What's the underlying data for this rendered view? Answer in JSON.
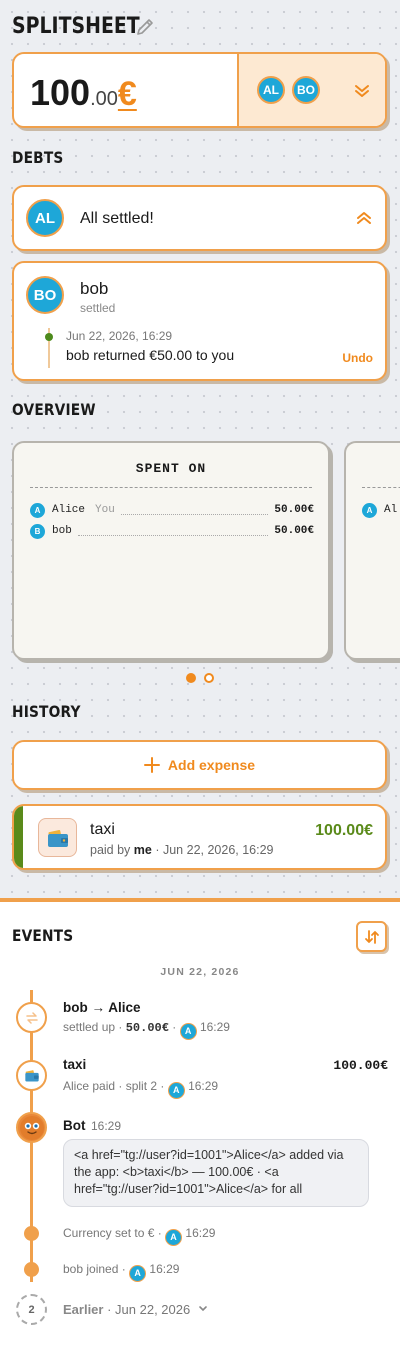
{
  "app": {
    "title": "SPLITSHEET",
    "edit_icon": "pencil-icon"
  },
  "total": {
    "integer": "100",
    "decimal": ".00",
    "currency": "€",
    "members": [
      "AL",
      "BO"
    ],
    "expand_icon": "double-chevron-down-icon"
  },
  "debts": {
    "title": "DEBTS",
    "summary": {
      "avatar": "AL",
      "text": "All settled!",
      "collapse_icon": "double-chevron-up-icon"
    },
    "entries": [
      {
        "avatar": "BO",
        "name": "bob",
        "status": "settled",
        "date": "Jun 22, 2026, 16:29",
        "message": "bob returned €50.00 to you",
        "action": "Undo"
      }
    ]
  },
  "overview": {
    "title": "OVERVIEW",
    "cards": [
      {
        "title": "SPENT ON",
        "rows": [
          {
            "badge": "A",
            "name": "Alice",
            "note": "You",
            "amount": "50.00€"
          },
          {
            "badge": "B",
            "name": "bob",
            "note": "",
            "amount": "50.00€"
          }
        ]
      },
      {
        "title": "",
        "rows": [
          {
            "badge": "A",
            "name": "Al"
          }
        ]
      }
    ],
    "pager": {
      "pages": 2,
      "current": 1
    }
  },
  "history": {
    "title": "HISTORY",
    "add_label": "Add expense",
    "expenses": [
      {
        "name": "taxi",
        "paid_by_prefix": "paid by",
        "paid_by": "me",
        "date": "Jun 22, 2026, 16:29",
        "amount": "100.00€",
        "icon": "wallet-icon"
      }
    ]
  },
  "events": {
    "title": "EVENTS",
    "sort_icon": "sort-arrows-icon",
    "date_header": "JUN 22, 2026",
    "items": [
      {
        "kind": "settle",
        "title": "bob → Alice",
        "sub_prefix": "settled up ·",
        "amount": "50.00€",
        "badge": "A",
        "time": "16:29",
        "icon": "exchange-icon"
      },
      {
        "kind": "expense",
        "title": "taxi",
        "sub_prefix": "Alice paid · split 2 ·",
        "badge": "A",
        "time": "16:29",
        "amount": "100.00€",
        "icon": "wallet-icon"
      },
      {
        "kind": "bot",
        "title": "Bot",
        "time": "16:29",
        "message": "<a href=\"tg://user?id=1001\">Alice</a> added via the app: <b>taxi</b> — 100.00€ · <a href=\"tg://user?id=1001\">Alice</a> for all",
        "icon": "bot-face-icon"
      },
      {
        "kind": "system",
        "text": "Currency set to € ·",
        "badge": "A",
        "time": "16:29"
      },
      {
        "kind": "system",
        "text": "bob joined ·",
        "badge": "A",
        "time": "16:29"
      }
    ],
    "earlier": {
      "count": "2",
      "label": "Earlier",
      "date": "· Jun 22, 2026",
      "chevron": "chevron-down-icon"
    }
  },
  "colors": {
    "accent": "#f0a04b",
    "accent_text": "#f08a1e",
    "avatar": "#1ea7d8",
    "positive": "#5a8a1a"
  }
}
